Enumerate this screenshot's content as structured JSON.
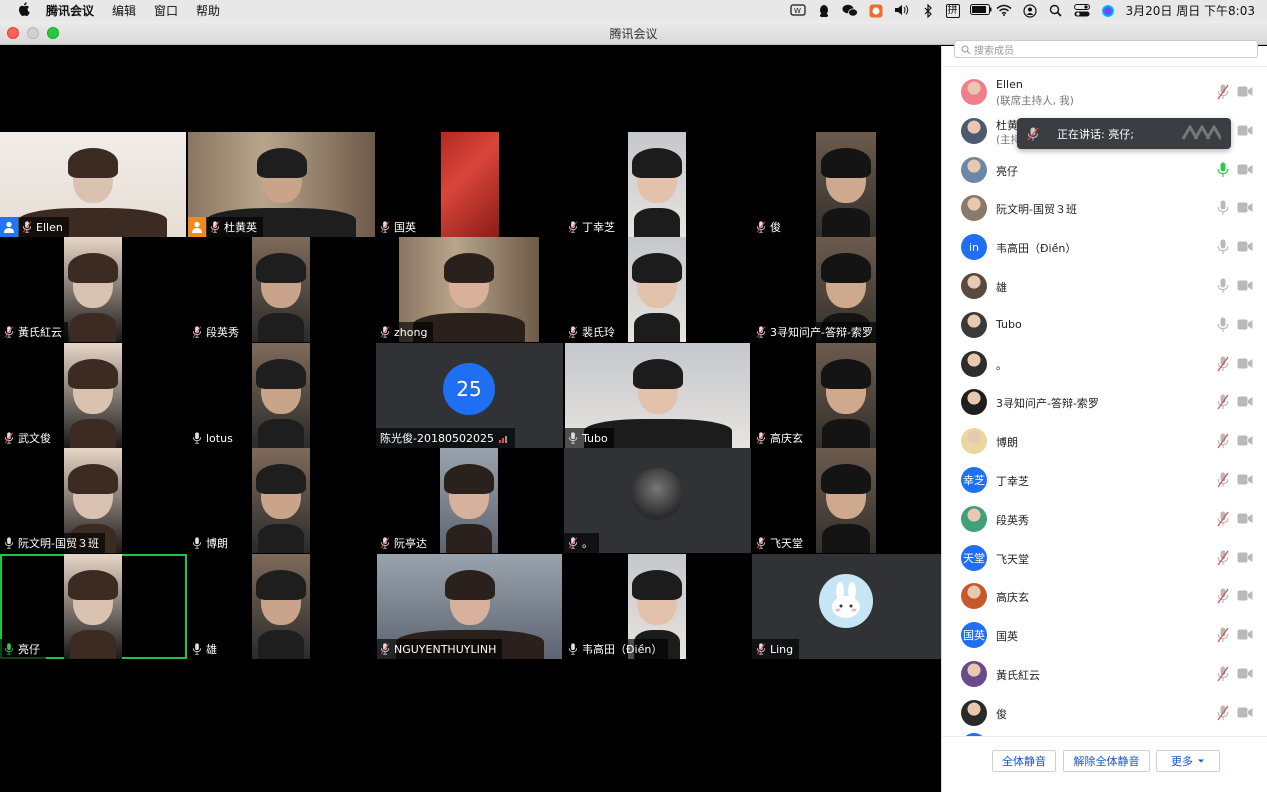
{
  "menubar": {
    "app_name": "腾讯会议",
    "menus": [
      "编辑",
      "窗口",
      "帮助"
    ],
    "clock": "3月20日 周日 下午8:03",
    "ime": "拼"
  },
  "window": {
    "title": "腾讯会议"
  },
  "tiles": [
    {
      "name": "Ellen",
      "row": 0,
      "col": 0,
      "host": "blue",
      "mic": "muted",
      "feed": "light"
    },
    {
      "name": "杜黄英",
      "row": 0,
      "col": 1,
      "host": "orange",
      "mic": "muted",
      "feed": "room"
    },
    {
      "name": "国英",
      "row": 0,
      "col": 2,
      "mic": "muted",
      "feed": "red"
    },
    {
      "name": "丁幸芝",
      "row": 0,
      "col": 3,
      "mic": "muted",
      "feed": "face"
    },
    {
      "name": "俊",
      "row": 0,
      "col": 4,
      "mic": "muted",
      "feed": "face"
    },
    {
      "name": "黃氏紅云",
      "row": 1,
      "col": 0,
      "mic": "muted",
      "feed": "face"
    },
    {
      "name": "段英秀",
      "row": 1,
      "col": 1,
      "mic": "muted",
      "feed": "face"
    },
    {
      "name": "zhong",
      "row": 1,
      "col": 2,
      "mic": "muted",
      "feed": "room"
    },
    {
      "name": "裴氏玲",
      "row": 1,
      "col": 3,
      "mic": "muted",
      "feed": "face"
    },
    {
      "name": "3寻知问产-答辩-索罗",
      "row": 1,
      "col": 4,
      "mic": "muted",
      "feed": "face"
    },
    {
      "name": "武文俊",
      "row": 2,
      "col": 0,
      "mic": "muted",
      "feed": "face"
    },
    {
      "name": "lotus",
      "row": 2,
      "col": 1,
      "mic": "on",
      "feed": "face"
    },
    {
      "name": "陈光俊-20180502025",
      "row": 2,
      "col": 2,
      "mic": "none",
      "feed": "avatar",
      "avatar_text": "25"
    },
    {
      "name": "Tubo",
      "row": 2,
      "col": 3,
      "mic": "on",
      "feed": "face"
    },
    {
      "name": "高庆玄",
      "row": 2,
      "col": 4,
      "mic": "muted",
      "feed": "face"
    },
    {
      "name": "阮文明-国贸３班",
      "row": 3,
      "col": 0,
      "mic": "on",
      "feed": "face"
    },
    {
      "name": "博朗",
      "row": 3,
      "col": 1,
      "mic": "on",
      "feed": "face"
    },
    {
      "name": "阮亭达",
      "row": 3,
      "col": 2,
      "mic": "muted",
      "feed": "face"
    },
    {
      "name": "。",
      "row": 3,
      "col": 3,
      "mic": "muted",
      "feed": "photo"
    },
    {
      "name": "飞天堂",
      "row": 3,
      "col": 4,
      "mic": "muted",
      "feed": "face"
    },
    {
      "name": "亮仔",
      "row": 4,
      "col": 0,
      "mic": "active",
      "feed": "face",
      "active": true
    },
    {
      "name": "雄",
      "row": 4,
      "col": 1,
      "mic": "on",
      "feed": "face"
    },
    {
      "name": "NGUYENTHUYLINH",
      "row": 4,
      "col": 2,
      "mic": "muted",
      "feed": "face"
    },
    {
      "name": "韦高田（Điền）",
      "row": 4,
      "col": 3,
      "mic": "on",
      "feed": "face"
    },
    {
      "name": "Ling",
      "row": 4,
      "col": 4,
      "mic": "muted",
      "feed": "bunny"
    }
  ],
  "panel": {
    "search_placeholder": "搜索成员",
    "participants": [
      {
        "name": "Ellen",
        "sub": "(联席主持人, 我)",
        "mic": "muted",
        "avatar": "img",
        "color": "#f07f8a"
      },
      {
        "name": "杜黄英",
        "sub": "(主持人)",
        "mic": "muted",
        "avatar": "img",
        "color": "#4b5a6e"
      },
      {
        "name": "亮仔",
        "mic": "active",
        "avatar": "img",
        "color": "#6a88a8"
      },
      {
        "name": "阮文明-国贸３班",
        "mic": "on",
        "avatar": "img",
        "color": "#8a7a6a"
      },
      {
        "name": "韦高田（Điền）",
        "mic": "on",
        "avatar": "text",
        "text": "in",
        "color": "#1f6ff2"
      },
      {
        "name": "雄",
        "mic": "on",
        "avatar": "img",
        "color": "#5a4a3e"
      },
      {
        "name": "Tubo",
        "mic": "on",
        "avatar": "img",
        "color": "#3a3a3a"
      },
      {
        "name": "。",
        "mic": "muted",
        "avatar": "img",
        "color": "#2d2d2d"
      },
      {
        "name": "3寻知问产-答辩-索罗",
        "mic": "muted",
        "avatar": "img",
        "color": "#1f1f1f"
      },
      {
        "name": "博朗",
        "mic": "muted",
        "avatar": "img",
        "color": "#e8d8a0"
      },
      {
        "name": "丁幸芝",
        "mic": "muted",
        "avatar": "text",
        "text": "幸芝",
        "color": "#1f6ff2"
      },
      {
        "name": "段英秀",
        "mic": "muted",
        "avatar": "img",
        "color": "#3fa07a"
      },
      {
        "name": "飞天堂",
        "mic": "muted",
        "avatar": "text",
        "text": "天堂",
        "color": "#1f6ff2"
      },
      {
        "name": "高庆玄",
        "mic": "muted",
        "avatar": "img",
        "color": "#c45a2a"
      },
      {
        "name": "国英",
        "mic": "muted",
        "avatar": "text",
        "text": "国英",
        "color": "#1f6ff2"
      },
      {
        "name": "黃氏紅云",
        "mic": "muted",
        "avatar": "img",
        "color": "#6a4a8a"
      },
      {
        "name": "俊",
        "mic": "muted",
        "avatar": "img",
        "color": "#2a2a2a"
      }
    ],
    "speaking_tooltip": "正在讲话: 亮仔;",
    "buttons": {
      "mute_all": "全体静音",
      "unmute_all": "解除全体静音",
      "more": "更多"
    }
  },
  "colors": {
    "accent": "#1f6ff2",
    "active_border": "#25c248",
    "muted_red": "#e5484d"
  }
}
